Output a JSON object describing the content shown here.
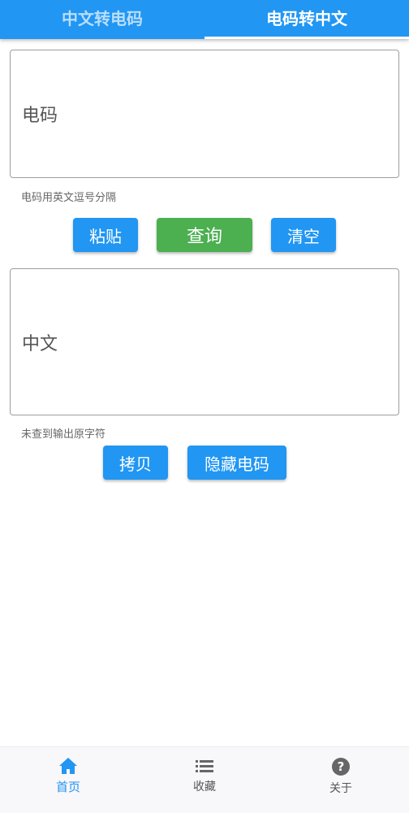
{
  "tabs": [
    {
      "label": "中文转电码",
      "active": false
    },
    {
      "label": "电码转中文",
      "active": true
    }
  ],
  "code_input": {
    "label": "电码",
    "helper": "电码用英文逗号分隔"
  },
  "buttons_row1": {
    "paste": "粘贴",
    "query": "查询",
    "clear": "清空"
  },
  "chinese_output": {
    "label": "中文",
    "helper": "未查到输出原字符"
  },
  "buttons_row2": {
    "copy": "拷贝",
    "hide_code": "隐藏电码"
  },
  "bottom_nav": {
    "items": [
      {
        "label": "首页",
        "icon": "home-icon",
        "active": true
      },
      {
        "label": "收藏",
        "icon": "list-icon",
        "active": false
      },
      {
        "label": "关于",
        "icon": "help-icon",
        "active": false
      }
    ]
  },
  "colors": {
    "primary": "#2196f3",
    "query_green": "#4caf50"
  }
}
